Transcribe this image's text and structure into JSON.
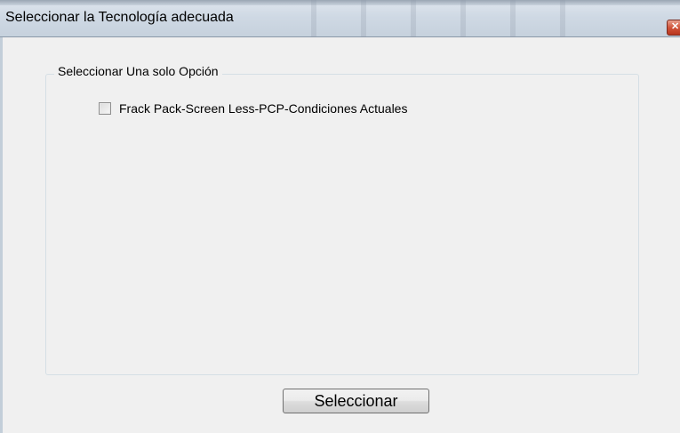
{
  "window": {
    "title": "Seleccionar la Tecnología adecuada",
    "close_icon": "close-icon"
  },
  "group": {
    "legend": "Seleccionar Una solo Opción",
    "options": [
      {
        "label": "Frack Pack-Screen Less-PCP-Condiciones Actuales",
        "checked": false
      }
    ]
  },
  "actions": {
    "select_label": "Seleccionar"
  }
}
